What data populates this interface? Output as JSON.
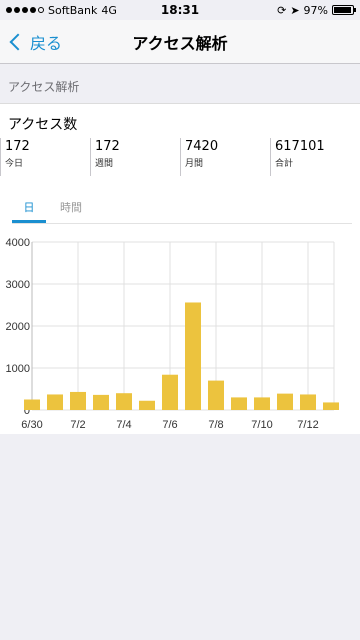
{
  "status_bar": {
    "carrier": "SoftBank",
    "network": "4G",
    "time": "18:31",
    "battery": "97%",
    "battery_level": 0.97
  },
  "nav": {
    "back_label": "戻る",
    "title": "アクセス解析"
  },
  "section": {
    "header": "アクセス解析"
  },
  "panel": {
    "title": "アクセス数",
    "stats": [
      {
        "value": "172",
        "label": "今日"
      },
      {
        "value": "172",
        "label": "週間"
      },
      {
        "value": "7420",
        "label": "月間"
      },
      {
        "value": "617101",
        "label": "合計"
      }
    ]
  },
  "tabs": [
    {
      "label": "日",
      "active": true
    },
    {
      "label": "時間",
      "active": false
    }
  ],
  "colors": {
    "accent": "#1a8fd0",
    "bar": "#ecc33e",
    "grid": "#e0e0e0"
  },
  "chart_data": {
    "type": "bar",
    "categories": [
      "6/30",
      "7/1",
      "7/2",
      "7/3",
      "7/4",
      "7/5",
      "7/6",
      "7/7",
      "7/8",
      "7/9",
      "7/10",
      "7/11",
      "7/12",
      "7/13"
    ],
    "values": [
      250,
      370,
      430,
      360,
      400,
      220,
      840,
      2560,
      700,
      300,
      300,
      390,
      370,
      180
    ],
    "x_tick_labels": [
      "6/30",
      "7/2",
      "7/4",
      "7/6",
      "7/8",
      "7/10",
      "7/12"
    ],
    "y_ticks": [
      0,
      1000,
      2000,
      3000,
      4000
    ],
    "ylim": [
      0,
      4000
    ],
    "grid": true
  }
}
